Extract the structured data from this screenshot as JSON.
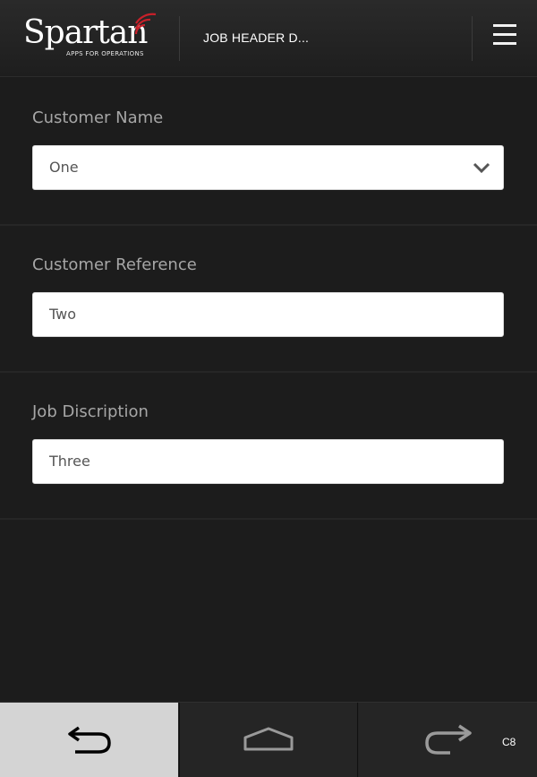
{
  "header": {
    "logo_text": "Spartan",
    "logo_tagline": "APPS FOR OPERATIONS",
    "title": "JOB HEADER D...",
    "menu_icon": "hamburger-menu-icon"
  },
  "form": {
    "customer_name": {
      "label": "Customer Name",
      "value": "One",
      "icon": "chevron-down-icon"
    },
    "customer_reference": {
      "label": "Customer Reference",
      "value": "Two"
    },
    "job_description": {
      "label": "Job Discription",
      "value": "Three"
    }
  },
  "footer": {
    "back_icon": "back-arrow-icon",
    "home_icon": "home-icon",
    "forward_icon": "forward-arrow-icon",
    "code": "C8"
  },
  "colors": {
    "accent": "#c8202a",
    "background": "#1c1c1c"
  }
}
